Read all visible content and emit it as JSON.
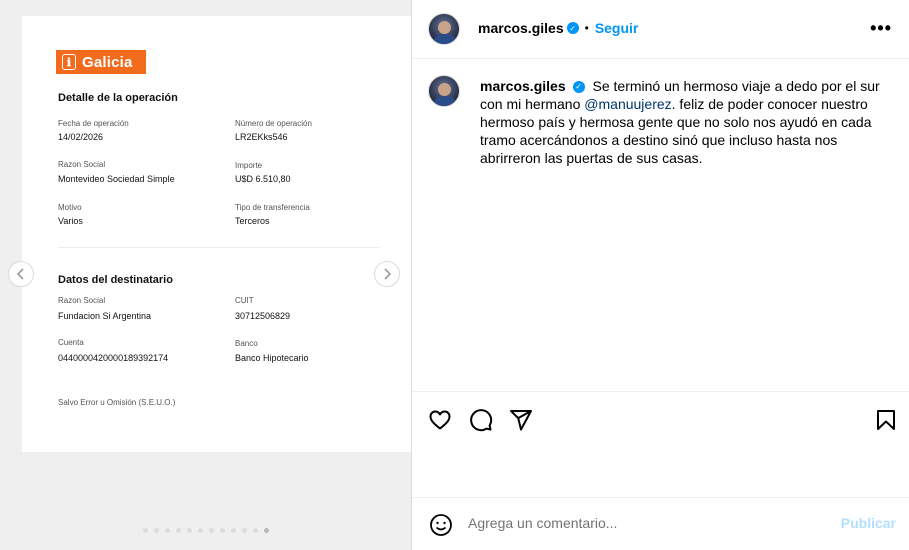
{
  "receipt": {
    "logo_text": "Galicia",
    "detail_title": "Detalle de la operación",
    "fields": [
      {
        "label": "Fecha de operación",
        "value": "14/02/2026"
      },
      {
        "label": "Número de operación",
        "value": "LR2EKks546"
      },
      {
        "label": "Razon Social",
        "value": "Montevideo Sociedad Simple"
      },
      {
        "label": "Importe",
        "value": "U$D 6.510,80"
      },
      {
        "label": "Motivo",
        "value": "Varios"
      },
      {
        "label": "Tipo de transferencia",
        "value": "Terceros"
      }
    ],
    "recipient_title": "Datos del destinatario",
    "recipient_fields": [
      {
        "label": "Razon Social",
        "value": "Fundacion Si Argentina"
      },
      {
        "label": "CUIT",
        "value": "30712506829"
      },
      {
        "label": "Cuenta",
        "value": "0440000420000189392174"
      },
      {
        "label": "Banco",
        "value": "Banco Hipotecario"
      }
    ],
    "footer": "Salvo Error u Omisión (S.E.U.O.)"
  },
  "carousel": {
    "prev_icon": "chevron-left-icon",
    "next_icon": "chevron-right-icon",
    "active_dot_index": 11,
    "dot_count": 12
  },
  "post": {
    "username": "marcos.giles",
    "separator": "•",
    "follow_label": "Seguir",
    "more_label": "•••",
    "caption_before": "Se terminó un hermoso viaje a dedo por el sur con mi hermano ",
    "caption_mention": "@manuujerez",
    "caption_after": ". feliz de poder conocer nuestro hermoso país y hermosa gente que no solo nos ayudó en cada tramo acercándonos a destino sinó que incluso hasta nos abrirreron las puertas de sus casas."
  },
  "actions": {
    "like_icon": "heart-icon",
    "comment_icon": "comment-icon",
    "share_icon": "share-icon",
    "save_icon": "bookmark-icon"
  },
  "comment": {
    "emoji_icon": "smiley-icon",
    "placeholder": "Agrega un comentario...",
    "publish_label": "Publicar"
  },
  "colors": {
    "accent": "#0095f6",
    "brand_orange": "#f26b1d",
    "publish_disabled": "#b2dffc",
    "mention": "#00376b"
  }
}
